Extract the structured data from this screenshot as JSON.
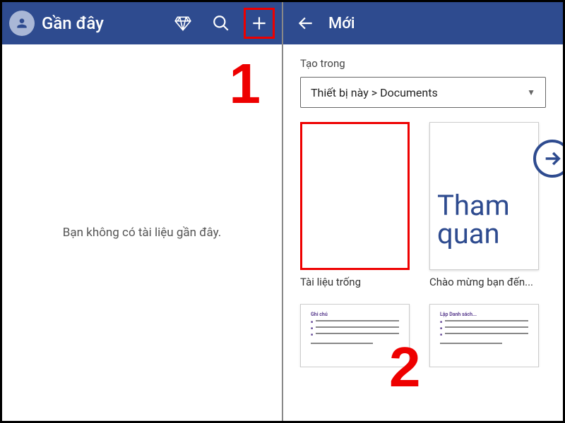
{
  "left": {
    "title": "Gần đây",
    "empty_message": "Bạn không có tài liệu gần đây."
  },
  "annotations": {
    "step1": "1",
    "step2": "2"
  },
  "right": {
    "title": "Mới",
    "create_in_label": "Tạo trong",
    "create_in_value": "Thiết bị này > Documents",
    "templates": [
      {
        "id": "blank",
        "label": "Tài liệu trống"
      },
      {
        "id": "tour",
        "label": "Chào mừng bạn đến...",
        "thumb_text": "Tham quan"
      }
    ],
    "row2_titles": [
      "Ghi chú",
      "Lập Danh sách..."
    ]
  }
}
